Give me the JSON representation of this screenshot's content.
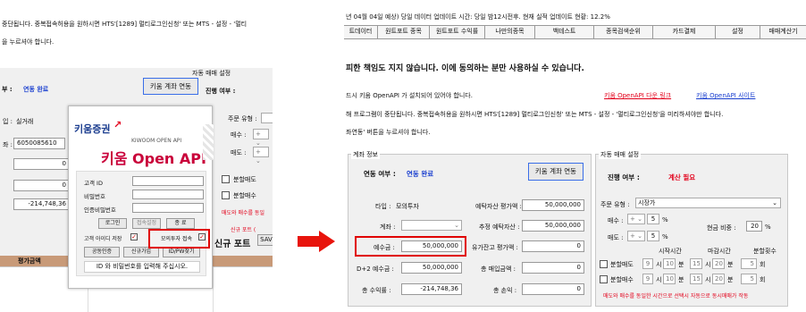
{
  "left": {
    "header_line1": "중단됩니다. 중복접속허용을 원하시면 HTS'[1289] 멀티로그인신청' 또는 MTS - 설정 - '멀티",
    "header_line2": "을 누르셔야 합니다.",
    "auto_trade_title": "자동 매매 설정",
    "status_label": "부 :",
    "status_value": "연동 완료",
    "connect_button": "키움 계좌 연동",
    "progress_label": "진행 여부 :",
    "type_label": "입 :",
    "type_value": "실거래",
    "order_type_label": "주문 유형 :",
    "account_label": "좌 :",
    "account_value": "6050085610",
    "buy_label": "매수 :",
    "sell_label": "매도 :",
    "amount1": "0",
    "amount2": "0",
    "amount3": "0",
    "amount4": "-214,748,36",
    "split_buy": "분할매도",
    "split_sell": "분할매수",
    "warning": "매도와 매수를 동일",
    "new_port": "신규 포트 (",
    "new_port2": "신규 포트",
    "save_btn": "SAV",
    "eval_label": "평가금액",
    "login": {
      "logo_kiwoom": "키움증권",
      "kiwoom_open_api": "KIWOOM OPEN API",
      "title": "키움 Open API",
      "id_label": "고객 ID",
      "pw_label": "비밀번호",
      "cert_label": "인증비밀번호",
      "login_btn": "로그인",
      "change_btn": "접속설정",
      "exit_btn": "종 료",
      "save_id_label": "고객 아이디 저장",
      "mock_label": "모의투자 접속",
      "cert_btn": "공동인증",
      "signup_btn": "신규가입",
      "idpw_btn": "ID/PW찾기",
      "notice": "ID 와 비밀번호를 입력해 주십시오."
    }
  },
  "right": {
    "update_line": "년 04월 04일 예상)  당일 데이터 업데이트 시간: 당일 밤12시전후.  현재 실적 업데이트 현황: 12.2%",
    "tabs": [
      "트데이터",
      "원트포트 종목",
      "원트포트 수익률",
      "나만의종목",
      "백테스트",
      "종목검색순위",
      "카드결제",
      "설정",
      "매매계산기"
    ],
    "disclaimer": "피한 책임도 지지 않습니다. 이에 동의하는 분만 사용하실 수 있습니다.",
    "install_note": "드시 키움 OpenAPI 가 설치되어 있어야 합니다.",
    "download_link": "키움 OpenAPI 다운 링크",
    "site_link": "키움 OpenAPI 사이트",
    "multi_note": "해 프로그램이 중단됩니다. 중복접속허용을 원하시면 HTS'[1289] 멀티로그인신청' 또는 MTS - 설정 - '멀티로그인신청'을 미리하셔야만 합니다.",
    "connect_note": "좌연동' 버튼을 누르셔야 합니다.",
    "account_info_title": "계좌 정보",
    "auto_trade_title": "자동 매매 설정",
    "link_label": "연동 여부 :",
    "link_value": "연동 완료",
    "connect_button": "키움 계좌 연동",
    "progress_label": "진행 여부 :",
    "progress_value": "계산 필요",
    "type_label": "타입 :",
    "type_value": "모의투자",
    "account_label": "계좌 :",
    "deposit_label": "예수금 :",
    "deposit_value": "50,000,000",
    "d2_label": "D+2 예수금 :",
    "d2_value": "50,000,000",
    "total_profit_label": "총 수익률 :",
    "total_profit_value": "-214,748,36",
    "eval_label": "예탁자산 평가액 :",
    "eval_value": "50,000,000",
    "est_label": "추정 예탁자산 :",
    "est_value": "50,000,000",
    "stock_eval_label": "유가잔고 평가액 :",
    "stock_eval_value": "0",
    "buy_amount_label": "총 매입금액 :",
    "buy_amount_value": "0",
    "total_pnl_label": "총 손익 :",
    "total_pnl_value": "0",
    "order_type_label": "주문 유형 :",
    "order_type_value": "시장가",
    "buy_label": "매수 :",
    "sell_label": "매도 :",
    "five": "5",
    "percent": "%",
    "cash_ratio_label": "현금 비중 :",
    "cash_ratio_value": "20",
    "start_time": "시작시간",
    "end_time": "마감시간",
    "split_count": "분할횟수",
    "split_sell_label": "분할매도",
    "split_buy_label": "분할매수",
    "nine": "9",
    "ten": "10",
    "fifteen": "15",
    "twenty": "20",
    "hour": "시",
    "minute": "분",
    "times": "회",
    "bottom_warning": "매도와 매수를 동일한 시간으로 선택시 자동으로 동시매매가 작동"
  }
}
